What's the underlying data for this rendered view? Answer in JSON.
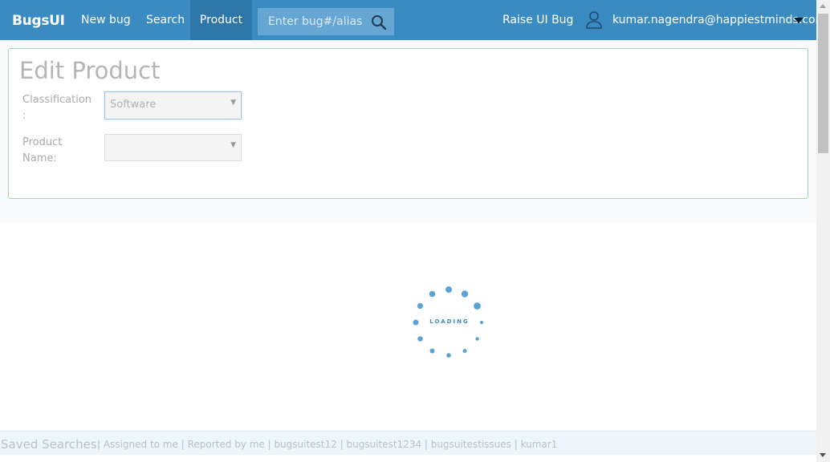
{
  "navbar": {
    "brand": "BugsUI",
    "items": [
      {
        "label": "New bug"
      },
      {
        "label": "Search"
      },
      {
        "label": "Product"
      }
    ],
    "search_placeholder": "Enter bug#/alias",
    "raise_ui_bug": "Raise UI Bug",
    "user_email": "kumar.nagendra@happiestminds.com"
  },
  "panel": {
    "title": "Edit Product",
    "classification_label_line1": "Classification",
    "classification_label_line2": ":",
    "classification_value": "Software",
    "product_label_line1": "Product",
    "product_label_line2": "Name:",
    "product_value": ""
  },
  "loader": {
    "text": "LOADING"
  },
  "footer": {
    "label": "Saved Searches:",
    "links": [
      "Assigned to me",
      "Reported by me",
      "bugsuitest12",
      "bugsuitest1234",
      "bugsuitestissues",
      "kumar1"
    ]
  },
  "colors": {
    "navbar": "#3a8bc2",
    "navbar_active": "#2f76a8",
    "panel_border": "#9fd6b4",
    "loader": "#5aa3d6"
  }
}
